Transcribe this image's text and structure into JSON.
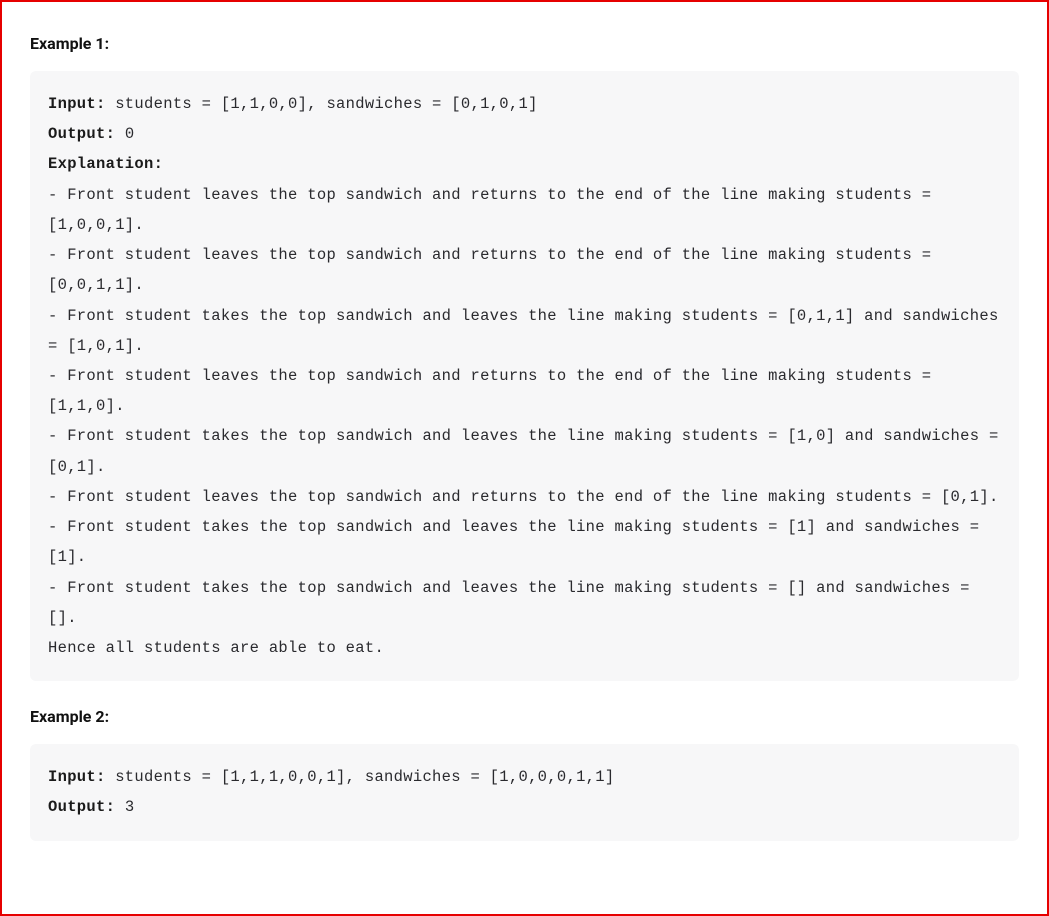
{
  "example1": {
    "heading": "Example 1:",
    "inputLabel": "Input:",
    "inputText": " students = [1,1,0,0], sandwiches = [0,1,0,1]",
    "outputLabel": "Output:",
    "outputText": " 0",
    "explanationLabel": "Explanation:",
    "body": "- Front student leaves the top sandwich and returns to the end of the line making students = [1,0,0,1].\n- Front student leaves the top sandwich and returns to the end of the line making students = [0,0,1,1].\n- Front student takes the top sandwich and leaves the line making students = [0,1,1] and sandwiches = [1,0,1].\n- Front student leaves the top sandwich and returns to the end of the line making students = [1,1,0].\n- Front student takes the top sandwich and leaves the line making students = [1,0] and sandwiches = [0,1].\n- Front student leaves the top sandwich and returns to the end of the line making students = [0,1].\n- Front student takes the top sandwich and leaves the line making students = [1] and sandwiches = [1].\n- Front student takes the top sandwich and leaves the line making students = [] and sandwiches = [].\nHence all students are able to eat."
  },
  "example2": {
    "heading": "Example 2:",
    "inputLabel": "Input:",
    "inputText": " students = [1,1,1,0,0,1], sandwiches = [1,0,0,0,1,1]",
    "outputLabel": "Output:",
    "outputText": " 3"
  }
}
